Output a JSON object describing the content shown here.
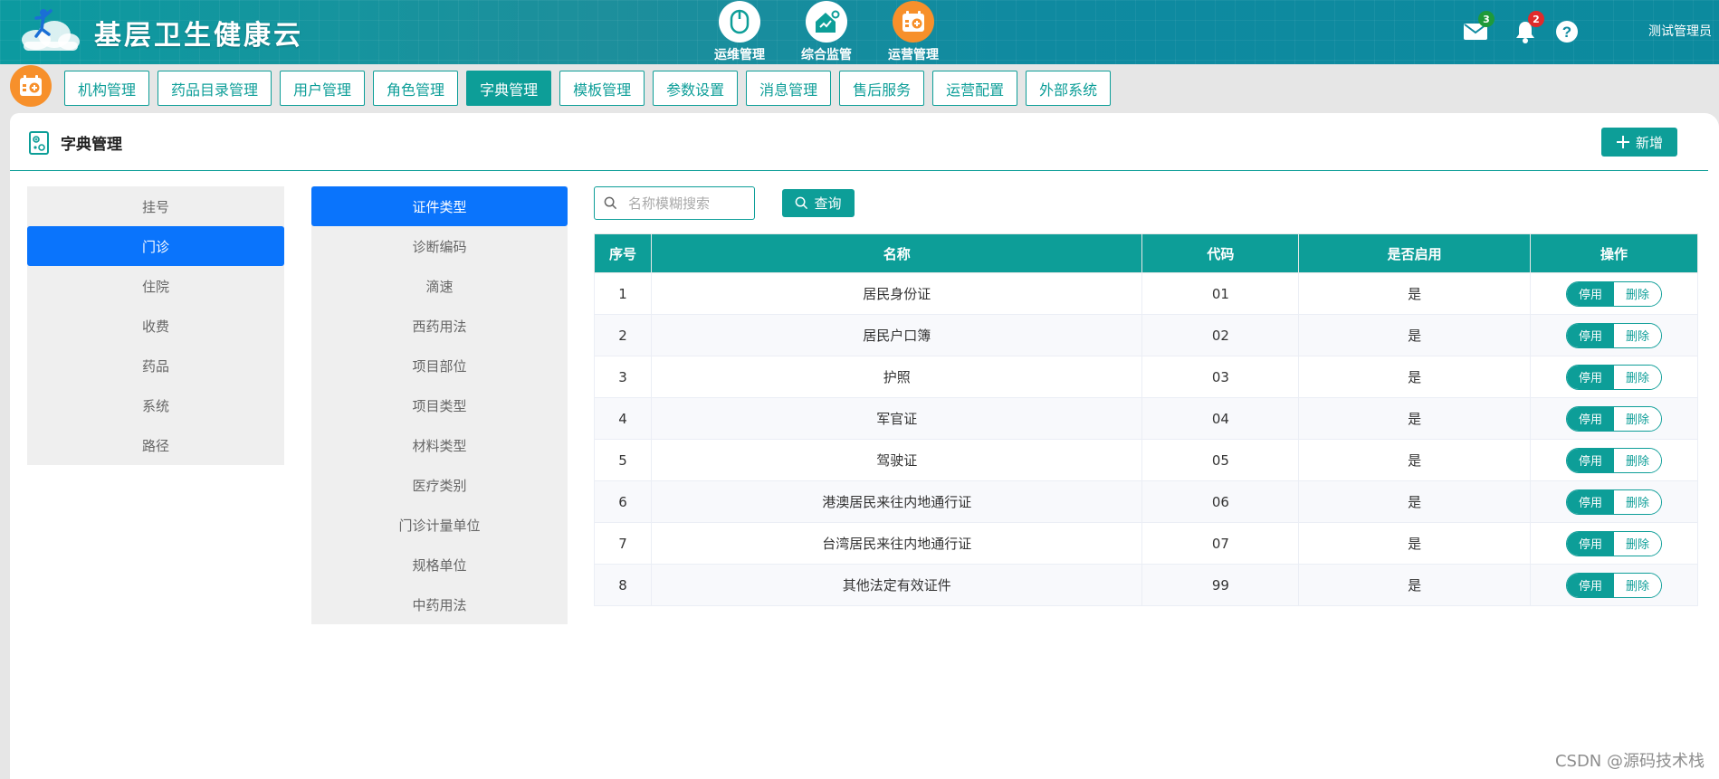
{
  "header": {
    "app_title": "基层卫生健康云",
    "modules": [
      {
        "label": "运维管理",
        "icon": "mouse-icon"
      },
      {
        "label": "综合监管",
        "icon": "home-monitor-icon"
      },
      {
        "label": "运营管理",
        "icon": "calendar-plus-icon"
      }
    ],
    "mail_badge": "3",
    "bell_badge": "2",
    "user_name": "测试管理员",
    "colors": {
      "mail_badge": "#1e9a3a",
      "bell_badge": "#e02b2b",
      "module_active": "#f7902b"
    }
  },
  "nav": {
    "tabs": [
      "机构管理",
      "药品目录管理",
      "用户管理",
      "角色管理",
      "字典管理",
      "模板管理",
      "参数设置",
      "消息管理",
      "售后服务",
      "运营配置",
      "外部系统"
    ],
    "active_tab": "字典管理"
  },
  "panel": {
    "title": "字典管理",
    "add_label": "新增"
  },
  "categories": [
    "挂号",
    "门诊",
    "住院",
    "收费",
    "药品",
    "系统",
    "路径"
  ],
  "active_category": "门诊",
  "subcategories": [
    "证件类型",
    "诊断编码",
    "滴速",
    "西药用法",
    "项目部位",
    "项目类型",
    "材料类型",
    "医疗类别",
    "门诊计量单位",
    "规格单位",
    "中药用法"
  ],
  "active_subcategory": "证件类型",
  "search": {
    "placeholder": "名称模糊搜索",
    "value": "",
    "button": "查询"
  },
  "table": {
    "columns": [
      "序号",
      "名称",
      "代码",
      "是否启用",
      "操作"
    ],
    "rows": [
      {
        "no": "1",
        "name": "居民身份证",
        "code": "01",
        "enabled": "是"
      },
      {
        "no": "2",
        "name": "居民户口簿",
        "code": "02",
        "enabled": "是"
      },
      {
        "no": "3",
        "name": "护照",
        "code": "03",
        "enabled": "是"
      },
      {
        "no": "4",
        "name": "军官证",
        "code": "04",
        "enabled": "是"
      },
      {
        "no": "5",
        "name": "驾驶证",
        "code": "05",
        "enabled": "是"
      },
      {
        "no": "6",
        "name": "港澳居民来往内地通行证",
        "code": "06",
        "enabled": "是"
      },
      {
        "no": "7",
        "name": "台湾居民来往内地通行证",
        "code": "07",
        "enabled": "是"
      },
      {
        "no": "8",
        "name": "其他法定有效证件",
        "code": "99",
        "enabled": "是"
      }
    ],
    "op_disable": "停用",
    "op_delete": "删除"
  },
  "watermark": "CSDN @源码技术栈",
  "accent_color": "#0d9e98",
  "selected_color": "#0a74fc"
}
